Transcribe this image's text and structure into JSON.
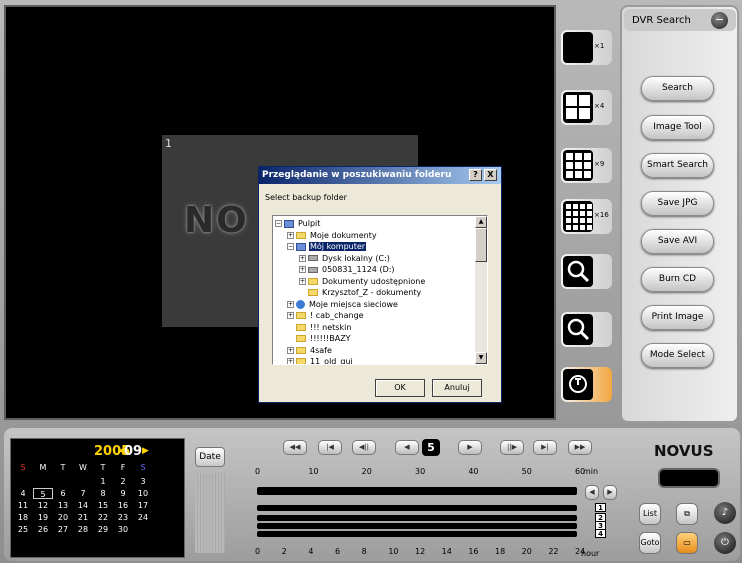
{
  "dialog": {
    "title": "Przeglądanie w poszukiwaniu folderu",
    "help_btn": "?",
    "close_btn": "X",
    "prompt": "Select backup folder",
    "tree": [
      {
        "label": "Pulpit",
        "pm": "−",
        "icon": "desktop"
      },
      {
        "label": "Moje dokumenty",
        "pm": "+",
        "icon": "folder"
      },
      {
        "label": "Mój komputer",
        "pm": "−",
        "icon": "computer",
        "selected": true
      },
      {
        "label": "Dysk lokalny (C:)",
        "pm": "+",
        "icon": "disk"
      },
      {
        "label": "050831_1124 (D:)",
        "pm": "+",
        "icon": "disk"
      },
      {
        "label": "Dokumenty udostępnione",
        "pm": "+",
        "icon": "folder"
      },
      {
        "label": "Krzysztof_Z - dokumenty",
        "pm": "",
        "icon": "folder"
      },
      {
        "label": "Moje miejsca sieciowe",
        "pm": "+",
        "icon": "network"
      },
      {
        "label": "! cab_change",
        "pm": "+",
        "icon": "folder"
      },
      {
        "label": "!!! netskin",
        "pm": "",
        "icon": "folder"
      },
      {
        "label": "!!!!!!BAZY",
        "pm": "",
        "icon": "folder"
      },
      {
        "label": "4safe",
        "pm": "+",
        "icon": "folder"
      },
      {
        "label": "11_old_gui",
        "pm": "+",
        "icon": "folder"
      }
    ],
    "ok": "OK",
    "cancel": "Anuluj"
  },
  "viewport": {
    "camera_number": "1",
    "logo": "NO"
  },
  "layouts": [
    "×1",
    "×4",
    "×9",
    "×16"
  ],
  "panel": {
    "title": "DVR Search",
    "minus": "−",
    "buttons": [
      "Search",
      "Image Tool",
      "Smart Search",
      "Save JPG",
      "Save AVI",
      "Burn CD",
      "Print Image",
      "Mode Select"
    ]
  },
  "calendar": {
    "year": "2005",
    "month": "09",
    "weekdays": [
      "S",
      "M",
      "T",
      "W",
      "T",
      "F",
      "S"
    ],
    "weeks": [
      [
        "",
        "",
        "",
        "",
        "1",
        "2",
        "3"
      ],
      [
        "4",
        "5",
        "6",
        "7",
        "8",
        "9",
        "10"
      ],
      [
        "11",
        "12",
        "13",
        "14",
        "15",
        "16",
        "17"
      ],
      [
        "18",
        "19",
        "20",
        "21",
        "22",
        "23",
        "24"
      ],
      [
        "25",
        "26",
        "27",
        "28",
        "29",
        "30",
        ""
      ]
    ],
    "selected_day": "5"
  },
  "date_label": "Date",
  "playback": {
    "buttons": [
      "◀◀",
      "|◀",
      "◀||",
      "◀",
      "▶",
      "||▶",
      "▶|",
      "▶▶"
    ],
    "channel": "5"
  },
  "timeline": {
    "top_ticks": [
      "0",
      "10",
      "20",
      "30",
      "40",
      "50",
      "60"
    ],
    "top_unit": "min",
    "bottom_ticks": [
      "0",
      "2",
      "4",
      "6",
      "8",
      "10",
      "12",
      "14",
      "16",
      "18",
      "20",
      "22",
      "24"
    ],
    "bottom_unit": "hour",
    "channels": [
      "1",
      "2",
      "3",
      "4"
    ]
  },
  "brand": "NOVUS",
  "list_label": "List",
  "goto_label": "Goto",
  "colors": {
    "accent": "#ffd300",
    "selection": "#0a246a"
  }
}
